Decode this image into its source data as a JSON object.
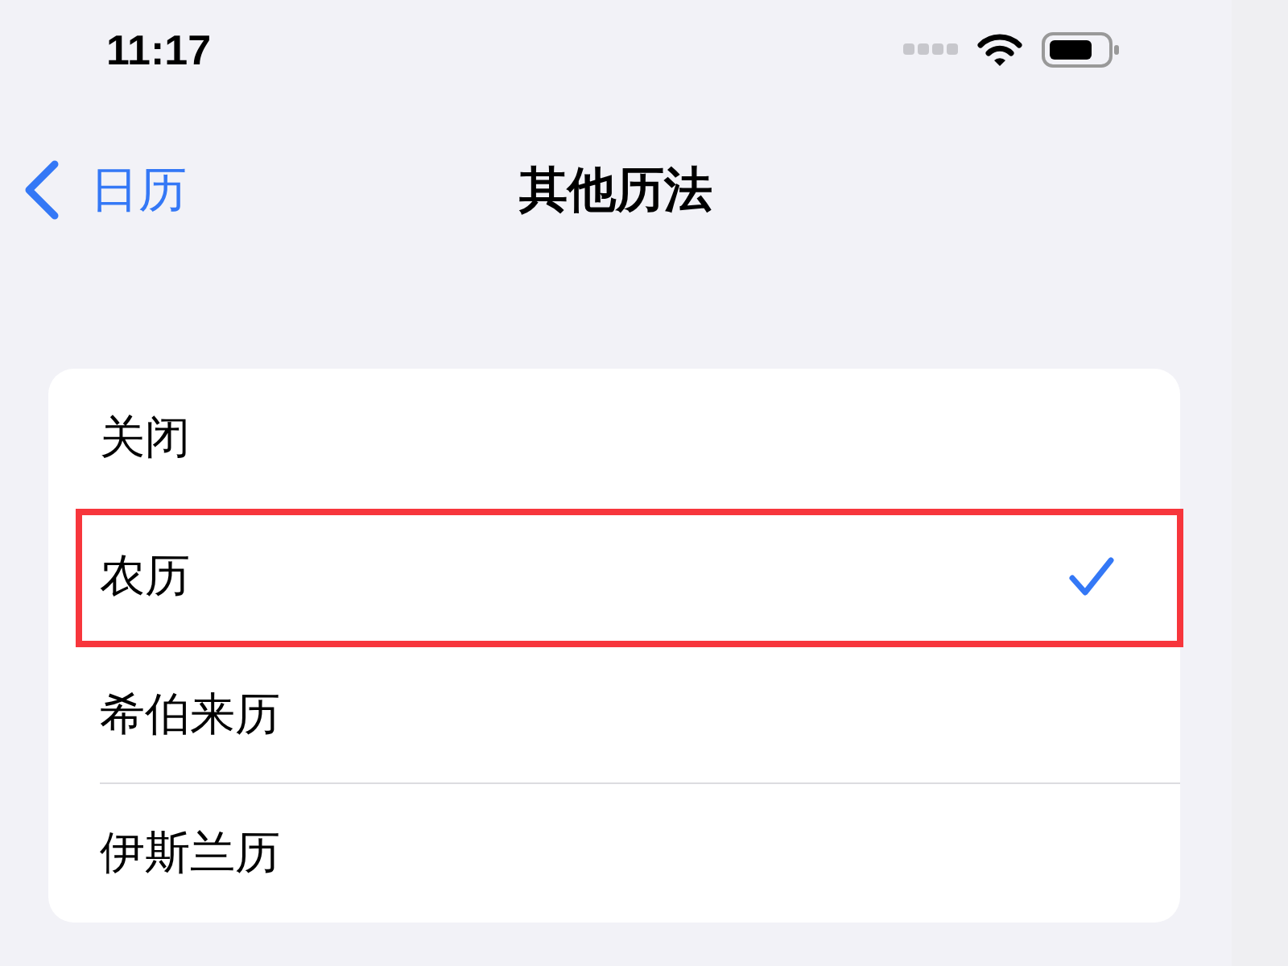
{
  "status_bar": {
    "time": "11:17"
  },
  "nav": {
    "back_label": "日历",
    "title": "其他历法"
  },
  "options": [
    {
      "label": "关闭",
      "selected": false,
      "highlighted": false
    },
    {
      "label": "农历",
      "selected": true,
      "highlighted": true
    },
    {
      "label": "希伯来历",
      "selected": false,
      "highlighted": false
    },
    {
      "label": "伊斯兰历",
      "selected": false,
      "highlighted": false
    }
  ]
}
